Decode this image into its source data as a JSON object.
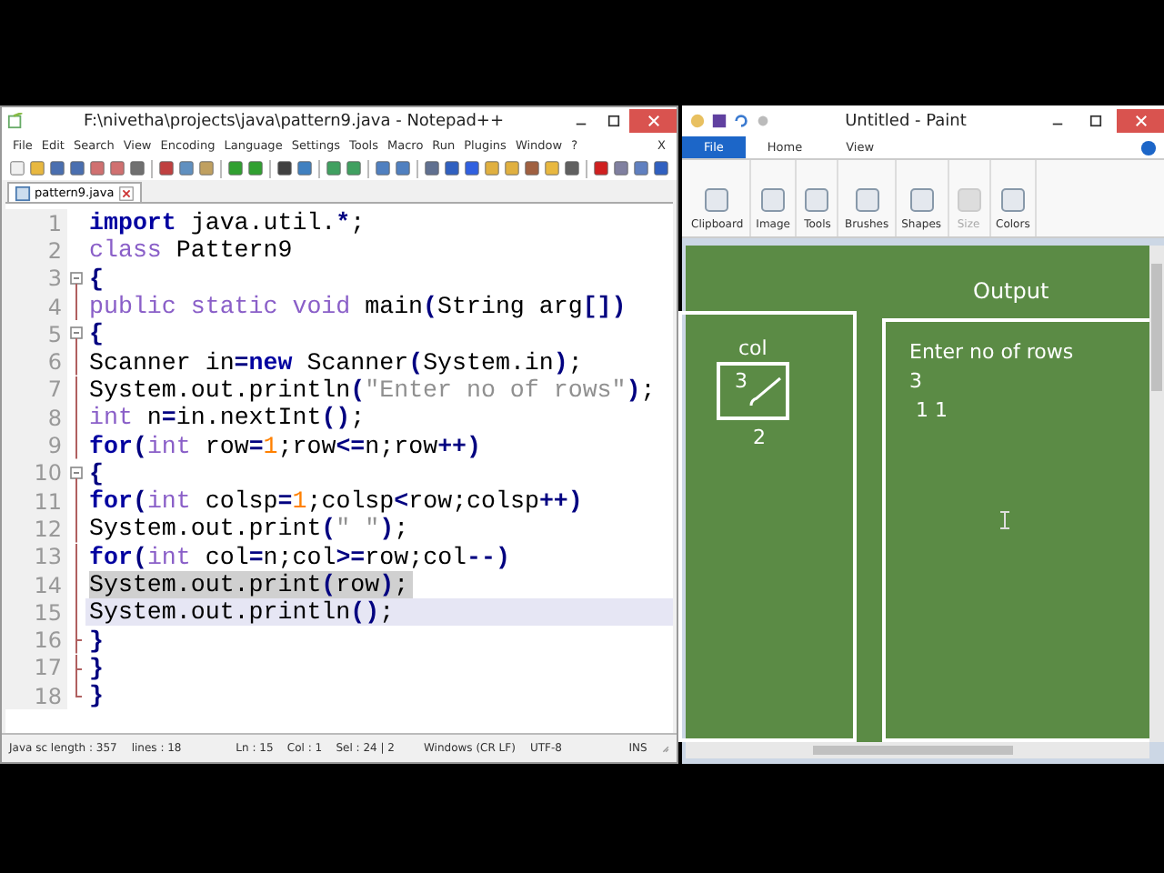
{
  "notepad": {
    "title": "F:\\nivetha\\projects\\java\\pattern9.java - Notepad++",
    "menu": [
      "File",
      "Edit",
      "Search",
      "View",
      "Encoding",
      "Language",
      "Settings",
      "Tools",
      "Macro",
      "Run",
      "Plugins",
      "Window",
      "?"
    ],
    "menu_close": "X",
    "tabs": [
      {
        "label": "pattern9.java",
        "selected": true
      }
    ],
    "lines": [
      {
        "number": "1",
        "kind": "plain",
        "selected": false,
        "current": false,
        "tokens": [
          {
            "kind": "keyword",
            "t": "import"
          },
          {
            "kind": "plain",
            "t": " java.util."
          },
          {
            "kind": "op",
            "t": "*"
          },
          {
            "kind": "plain",
            "t": ";"
          }
        ]
      },
      {
        "number": "2",
        "kind": "plain",
        "selected": false,
        "current": false,
        "tokens": [
          {
            "kind": "type",
            "t": "class"
          },
          {
            "kind": "plain",
            "t": " Pattern9"
          }
        ]
      },
      {
        "number": "3",
        "kind": "fold-open",
        "selected": false,
        "current": false,
        "tokens": [
          {
            "kind": "op",
            "t": "{"
          }
        ]
      },
      {
        "number": "4",
        "kind": "fold-body",
        "selected": false,
        "current": false,
        "tokens": [
          {
            "kind": "type",
            "t": "public static void"
          },
          {
            "kind": "plain",
            "t": " main"
          },
          {
            "kind": "op",
            "t": "("
          },
          {
            "kind": "plain",
            "t": "String arg"
          },
          {
            "kind": "op",
            "t": "[])"
          }
        ]
      },
      {
        "number": "5",
        "kind": "fold-open",
        "selected": false,
        "current": false,
        "tokens": [
          {
            "kind": "op",
            "t": "{"
          }
        ]
      },
      {
        "number": "6",
        "kind": "fold-body",
        "selected": false,
        "current": false,
        "tokens": [
          {
            "kind": "plain",
            "t": "Scanner in"
          },
          {
            "kind": "op",
            "t": "="
          },
          {
            "kind": "keyword",
            "t": "new"
          },
          {
            "kind": "plain",
            "t": " Scanner"
          },
          {
            "kind": "op",
            "t": "("
          },
          {
            "kind": "plain",
            "t": "System.in"
          },
          {
            "kind": "op",
            "t": ")"
          },
          {
            "kind": "plain",
            "t": ";"
          }
        ]
      },
      {
        "number": "7",
        "kind": "fold-body",
        "selected": false,
        "current": false,
        "tokens": [
          {
            "kind": "plain",
            "t": "System.out.println"
          },
          {
            "kind": "op",
            "t": "("
          },
          {
            "kind": "string",
            "t": "\"Enter no of rows\""
          },
          {
            "kind": "op",
            "t": ")"
          },
          {
            "kind": "plain",
            "t": ";"
          }
        ]
      },
      {
        "number": "8",
        "kind": "fold-body",
        "selected": false,
        "current": false,
        "tokens": [
          {
            "kind": "type",
            "t": "int"
          },
          {
            "kind": "plain",
            "t": " n"
          },
          {
            "kind": "op",
            "t": "="
          },
          {
            "kind": "plain",
            "t": "in.nextInt"
          },
          {
            "kind": "op",
            "t": "()"
          },
          {
            "kind": "plain",
            "t": ";"
          }
        ]
      },
      {
        "number": "9",
        "kind": "fold-body",
        "selected": false,
        "current": false,
        "tokens": [
          {
            "kind": "keyword",
            "t": "for"
          },
          {
            "kind": "op",
            "t": "("
          },
          {
            "kind": "type",
            "t": "int"
          },
          {
            "kind": "plain",
            "t": " row"
          },
          {
            "kind": "op",
            "t": "="
          },
          {
            "kind": "number",
            "t": "1"
          },
          {
            "kind": "plain",
            "t": ";row"
          },
          {
            "kind": "op",
            "t": "<="
          },
          {
            "kind": "plain",
            "t": "n;row"
          },
          {
            "kind": "op",
            "t": "++)"
          }
        ]
      },
      {
        "number": "10",
        "kind": "fold-open",
        "selected": false,
        "current": false,
        "tokens": [
          {
            "kind": "op",
            "t": "{"
          }
        ]
      },
      {
        "number": "11",
        "kind": "fold-body",
        "selected": false,
        "current": false,
        "tokens": [
          {
            "kind": "keyword",
            "t": "for"
          },
          {
            "kind": "op",
            "t": "("
          },
          {
            "kind": "type",
            "t": "int"
          },
          {
            "kind": "plain",
            "t": " colsp"
          },
          {
            "kind": "op",
            "t": "="
          },
          {
            "kind": "number",
            "t": "1"
          },
          {
            "kind": "plain",
            "t": ";colsp"
          },
          {
            "kind": "op",
            "t": "<"
          },
          {
            "kind": "plain",
            "t": "row;colsp"
          },
          {
            "kind": "op",
            "t": "++)"
          }
        ]
      },
      {
        "number": "12",
        "kind": "fold-body",
        "selected": false,
        "current": false,
        "tokens": [
          {
            "kind": "plain",
            "t": "System.out.print"
          },
          {
            "kind": "op",
            "t": "("
          },
          {
            "kind": "string",
            "t": "\" \""
          },
          {
            "kind": "op",
            "t": ")"
          },
          {
            "kind": "plain",
            "t": ";"
          }
        ]
      },
      {
        "number": "13",
        "kind": "fold-body",
        "selected": false,
        "current": false,
        "tokens": [
          {
            "kind": "keyword",
            "t": "for"
          },
          {
            "kind": "op",
            "t": "("
          },
          {
            "kind": "type",
            "t": "int"
          },
          {
            "kind": "plain",
            "t": " col"
          },
          {
            "kind": "op",
            "t": "="
          },
          {
            "kind": "plain",
            "t": "n;col"
          },
          {
            "kind": "op",
            "t": ">="
          },
          {
            "kind": "plain",
            "t": "row;col"
          },
          {
            "kind": "op",
            "t": "--)"
          }
        ]
      },
      {
        "number": "14",
        "kind": "fold-body",
        "selected": true,
        "current": false,
        "tokens": [
          {
            "kind": "plain",
            "t": "System.out.print"
          },
          {
            "kind": "op",
            "t": "("
          },
          {
            "kind": "plain",
            "t": "row"
          },
          {
            "kind": "op",
            "t": ")"
          },
          {
            "kind": "plain",
            "t": ";"
          }
        ]
      },
      {
        "number": "15",
        "kind": "fold-body",
        "selected": false,
        "current": true,
        "tokens": [
          {
            "kind": "plain",
            "t": "System.out.println"
          },
          {
            "kind": "op",
            "t": "()"
          },
          {
            "kind": "plain",
            "t": ";"
          }
        ]
      },
      {
        "number": "16",
        "kind": "fold-close",
        "selected": false,
        "current": false,
        "tokens": [
          {
            "kind": "op",
            "t": "}"
          }
        ]
      },
      {
        "number": "17",
        "kind": "fold-close",
        "selected": false,
        "current": false,
        "tokens": [
          {
            "kind": "op",
            "t": "}"
          }
        ]
      },
      {
        "number": "18",
        "kind": "fold-end",
        "selected": false,
        "current": false,
        "tokens": [
          {
            "kind": "op",
            "t": "}"
          }
        ]
      }
    ],
    "status_bar": {
      "length": "Java sc length : 357",
      "lines": "lines : 18",
      "position": "Ln : 15    Col : 1    Sel : 24 | 2",
      "eol": "Windows (CR LF)",
      "encoding": "UTF-8",
      "mode": "INS"
    }
  },
  "paint": {
    "title": "Untitled - Paint",
    "tabs": [
      {
        "label": "File",
        "selected": true
      },
      {
        "label": "Home",
        "selected": false
      },
      {
        "label": "View",
        "selected": false
      }
    ],
    "groups": [
      {
        "label": "Clipboard",
        "disabled": false
      },
      {
        "label": "Image",
        "disabled": false
      },
      {
        "label": "Tools",
        "disabled": false
      },
      {
        "label": "Brushes",
        "disabled": false
      },
      {
        "label": "Shapes",
        "disabled": false
      },
      {
        "label": "Size",
        "disabled": true
      },
      {
        "label": "Colors",
        "disabled": false
      }
    ],
    "canvas": {
      "col_label": "col",
      "struck_value": "3",
      "new_value": "2",
      "output_title": "Output",
      "output_lines": [
        "Enter no of rows",
        "3",
        " 1 1"
      ]
    }
  }
}
